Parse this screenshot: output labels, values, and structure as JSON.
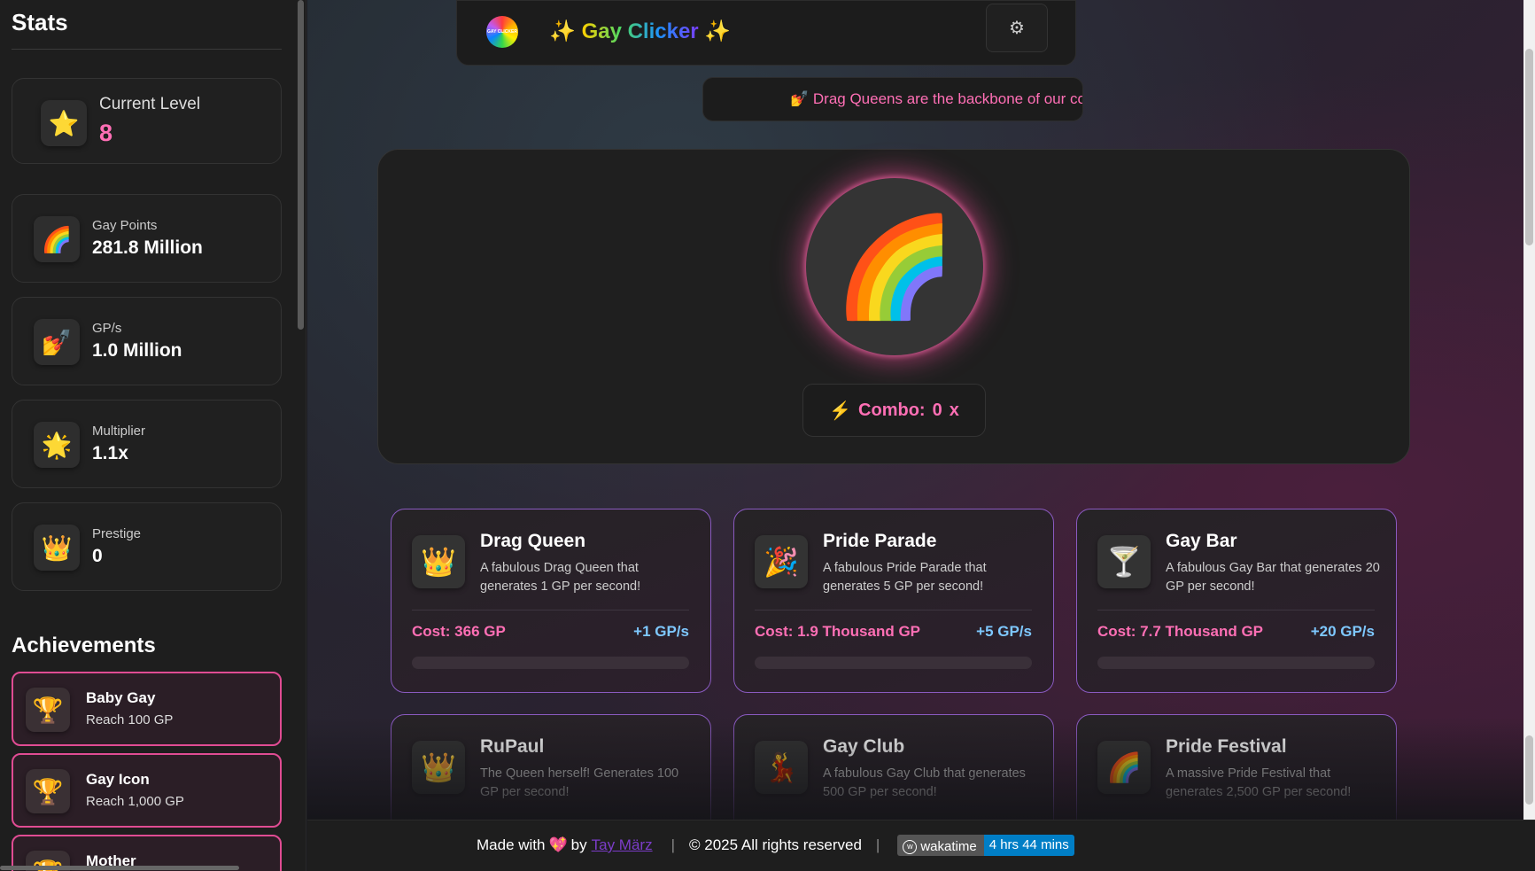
{
  "sidebar": {
    "title": "Stats",
    "level": {
      "label": "Current Level",
      "value": "8",
      "icon": "star-icon"
    },
    "stats": [
      {
        "label": "Gay Points",
        "value": "281.8 Million",
        "icon": "rainbow-icon"
      },
      {
        "label": "GP/s",
        "value": "1.0 Million",
        "icon": "nail-polish-icon"
      },
      {
        "label": "Multiplier",
        "value": "1.1x",
        "icon": "glowing-star-icon"
      },
      {
        "label": "Prestige",
        "value": "0",
        "icon": "crown-icon"
      }
    ],
    "achievements_title": "Achievements",
    "achievements": [
      {
        "name": "Baby Gay",
        "desc": "Reach 100 GP",
        "icon": "trophy-icon"
      },
      {
        "name": "Gay Icon",
        "desc": "Reach 1,000 GP",
        "icon": "trophy-icon"
      },
      {
        "name": "Mother",
        "desc": "",
        "icon": "trophy-icon"
      }
    ]
  },
  "header": {
    "logo_text": "GAY CLICKER",
    "title_prefix": "✨ ",
    "title": "Gay Clicker",
    "title_suffix": " ✨",
    "settings_icon": "⚙"
  },
  "ticker": {
    "text": "💅 Drag Queens are the backbone of our community!"
  },
  "clicker": {
    "button_icon": "🌈",
    "combo_icon": "⚡",
    "combo_label": "Combo:",
    "combo_value": "0",
    "combo_suffix": "x"
  },
  "upgrades": [
    {
      "name": "Drag Queen",
      "desc": "A fabulous Drag Queen that generates 1 GP per second!",
      "cost": "Cost: 366 GP",
      "rate": "+1 GP/s",
      "icon": "👑"
    },
    {
      "name": "Pride Parade",
      "desc": "A fabulous Pride Parade that generates 5 GP per second!",
      "cost": "Cost: 1.9 Thousand GP",
      "rate": "+5 GP/s",
      "icon": "🎉"
    },
    {
      "name": "Gay Bar",
      "desc": "A fabulous Gay Bar that generates 20 GP per second!",
      "cost": "Cost: 7.7 Thousand GP",
      "rate": "+20 GP/s",
      "icon": "🍸"
    },
    {
      "name": "RuPaul",
      "desc": "The Queen herself! Generates 100 GP per second!",
      "icon": "👑"
    },
    {
      "name": "Gay Club",
      "desc": "A fabulous Gay Club that generates 500 GP per second!",
      "icon": "💃"
    },
    {
      "name": "Pride Festival",
      "desc": "A massive Pride Festival that generates 2,500 GP per second!",
      "icon": "🌈"
    }
  ],
  "footer": {
    "made_with": "Made with",
    "heart": "💖",
    "by": "by",
    "author": "Tay März",
    "copyright": "© 2025 All rights reserved",
    "wakatime_label": "wakatime",
    "wakatime_value": "4 hrs 44 mins"
  },
  "colors": {
    "accent_pink": "#ff6fb5",
    "accent_blue": "#7ec8ff",
    "card_border": "#8a5ac0"
  }
}
